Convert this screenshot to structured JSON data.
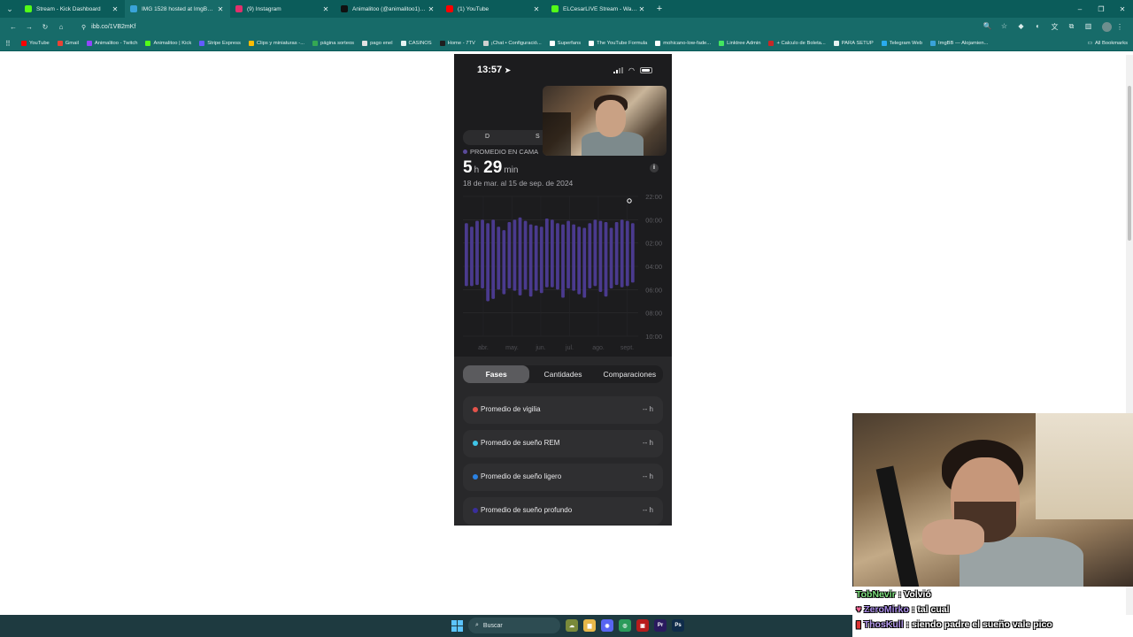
{
  "browser": {
    "tabs": [
      {
        "title": "Stream - Kick Dashboard",
        "fav_color": "#53fc18",
        "active": false
      },
      {
        "title": "IMG 1528 hosted at ImgBB — I",
        "fav_color": "#3aa3d9",
        "active": true
      },
      {
        "title": "(9) Instagram",
        "fav_color": "#e1306c",
        "active": false
      },
      {
        "title": "Animalitoo (@animalitoo1) | Ti",
        "fav_color": "#111111",
        "active": false
      },
      {
        "title": "(1) YouTube",
        "fav_color": "#ff0000",
        "active": false
      },
      {
        "title": "ELCesarLIVE Stream - Watch Li",
        "fav_color": "#53fc18",
        "active": false
      }
    ],
    "address": "ibb.co/1VB2mKf",
    "bookmarks": [
      {
        "label": "YouTube",
        "color": "#ff0000"
      },
      {
        "label": "Gmail",
        "color": "#ea4335"
      },
      {
        "label": "Animalitoo - Twitch",
        "color": "#9146ff"
      },
      {
        "label": "Animalitoo | Kick",
        "color": "#53fc18"
      },
      {
        "label": "Stripe Express",
        "color": "#635bff"
      },
      {
        "label": "Clips y miniaturas -...",
        "color": "#fbbc04"
      },
      {
        "label": "página sorteos",
        "color": "#34a853"
      },
      {
        "label": "pago enel",
        "color": "#e2e2e2"
      },
      {
        "label": "CASINOS",
        "color": "#e6f2f1"
      },
      {
        "label": "Home - 7TV",
        "color": "#1f1f1f"
      },
      {
        "label": "¡Chat • Configuració...",
        "color": "#d0d0d0"
      },
      {
        "label": "Superfans",
        "color": "#ffffff"
      },
      {
        "label": "The YouTube Formula",
        "color": "#ffffff"
      },
      {
        "label": "mohicano-low-fade...",
        "color": "#ffffff"
      },
      {
        "label": "Linktree Admin",
        "color": "#43e660"
      },
      {
        "label": "+ Calculo de Boleta...",
        "color": "#c62828"
      },
      {
        "label": "PARA SETUP",
        "color": "#e6f2f1"
      },
      {
        "label": "Telegram Web",
        "color": "#2aabee"
      },
      {
        "label": "ImgBB — Alojamien...",
        "color": "#3aa3d9"
      }
    ],
    "all_bookmarks": "All Bookmarks"
  },
  "phone": {
    "time": "13:57",
    "segment_labels": [
      "D",
      "S"
    ],
    "legend": "PROMEDIO EN CAMA",
    "avg_hours": "5",
    "avg_hours_unit": "h",
    "avg_minutes": "29",
    "avg_minutes_unit": "min",
    "range": "18 de mar. al 15 de sep. de 2024",
    "info": "i",
    "tabs": [
      "Fases",
      "Cantidades",
      "Comparaciones"
    ],
    "stages": [
      {
        "label": "Promedio de vigilia",
        "value": "-- h",
        "color": "#e5534b"
      },
      {
        "label": "Promedio de sueño REM",
        "value": "-- h",
        "color": "#3fc5e8"
      },
      {
        "label": "Promedio de sueño ligero",
        "value": "-- h",
        "color": "#2a82e4"
      },
      {
        "label": "Promedio de sueño profundo",
        "value": "-- h",
        "color": "#3a2f9c"
      }
    ]
  },
  "chart_data": {
    "type": "bar",
    "title": "",
    "y_tick_labels": [
      "22:00",
      "00:00",
      "02:00",
      "04:00",
      "06:00",
      "08:00",
      "10:00"
    ],
    "x_tick_labels": [
      "abr.",
      "may.",
      "jun.",
      "jul.",
      "ago.",
      "sept."
    ],
    "bar_color": "#4a3a8e",
    "y_range_hours_from_2200": [
      0,
      12
    ],
    "bars": [
      {
        "start": 2.3,
        "end": 7.7
      },
      {
        "start": 2.6,
        "end": 7.7
      },
      {
        "start": 2.1,
        "end": 7.6
      },
      {
        "start": 2.0,
        "end": 7.9
      },
      {
        "start": 2.3,
        "end": 9.0
      },
      {
        "start": 2.0,
        "end": 8.8
      },
      {
        "start": 2.6,
        "end": 8.0
      },
      {
        "start": 2.9,
        "end": 8.4
      },
      {
        "start": 2.2,
        "end": 7.9
      },
      {
        "start": 2.0,
        "end": 8.1
      },
      {
        "start": 1.8,
        "end": 8.5
      },
      {
        "start": 2.1,
        "end": 8.0
      },
      {
        "start": 2.4,
        "end": 8.6
      },
      {
        "start": 2.5,
        "end": 8.1
      },
      {
        "start": 2.6,
        "end": 8.3
      },
      {
        "start": 1.9,
        "end": 7.8
      },
      {
        "start": 2.0,
        "end": 7.8
      },
      {
        "start": 2.3,
        "end": 8.0
      },
      {
        "start": 2.4,
        "end": 8.7
      },
      {
        "start": 2.1,
        "end": 7.9
      },
      {
        "start": 2.4,
        "end": 8.1
      },
      {
        "start": 2.6,
        "end": 8.4
      },
      {
        "start": 2.7,
        "end": 8.7
      },
      {
        "start": 2.3,
        "end": 7.9
      },
      {
        "start": 2.0,
        "end": 7.7
      },
      {
        "start": 2.1,
        "end": 8.2
      },
      {
        "start": 2.2,
        "end": 8.6
      },
      {
        "start": 2.7,
        "end": 7.9
      },
      {
        "start": 2.2,
        "end": 7.6
      },
      {
        "start": 2.0,
        "end": 7.8
      },
      {
        "start": 2.1,
        "end": 7.7
      },
      {
        "start": 2.3,
        "end": 7.4
      }
    ]
  },
  "chat": [
    {
      "user": "TobNevir",
      "user_color": "#7de07d",
      "message": "Volvió"
    },
    {
      "user": "ZeroMirko",
      "user_color": "#a98be8",
      "message": "tal cual"
    },
    {
      "user": "ThosKull",
      "user_color": "#b79cf0",
      "message": "siendo padre el sueño vale pico"
    }
  ],
  "taskbar": {
    "search_placeholder": "Buscar"
  }
}
